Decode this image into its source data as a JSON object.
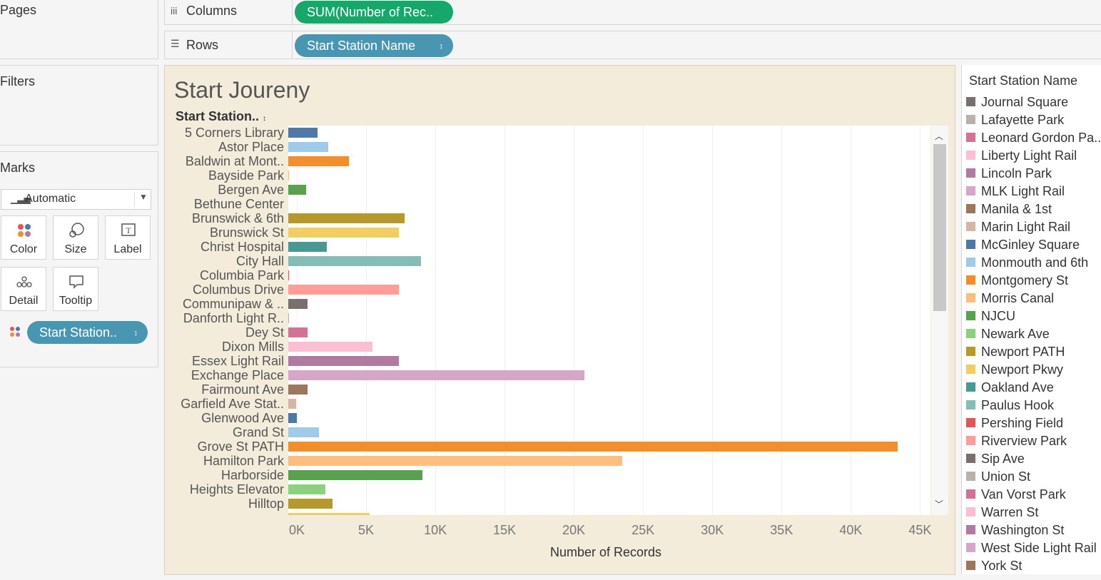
{
  "left": {
    "pages_title": "Pages",
    "filters_title": "Filters",
    "marks_title": "Marks",
    "mark_type": "Automatic",
    "mark_cards": [
      "Color",
      "Size",
      "Label",
      "Detail",
      "Tooltip"
    ],
    "color_pill": "Start Station.."
  },
  "shelves": {
    "columns_label": "Columns",
    "columns_pill": "SUM(Number of Rec..",
    "rows_label": "Rows",
    "rows_pill": "Start Station Name"
  },
  "colors": {
    "columns_pill": "#15a86a",
    "rows_pill": "#4996b2",
    "view_bg": "#f3ecdb"
  },
  "chart_data": {
    "type": "bar",
    "orientation": "horizontal",
    "title": "Start Joureny",
    "row_header": "Start Station..",
    "xlabel": "Number of Records",
    "xlim": [
      0,
      46000
    ],
    "x_ticks": [
      "0K",
      "5K",
      "10K",
      "15K",
      "20K",
      "25K",
      "30K",
      "35K",
      "40K",
      "45K"
    ],
    "categories": [
      "5 Corners Library",
      "Astor Place",
      "Baldwin at Mont..",
      "Bayside Park",
      "Bergen Ave",
      "Bethune Center",
      "Brunswick & 6th",
      "Brunswick St",
      "Christ Hospital",
      "City Hall",
      "Columbia Park",
      "Columbus Drive",
      "Communipaw & ..",
      "Danforth Light R..",
      "Dey St",
      "Dixon Mills",
      "Essex Light Rail",
      "Exchange Place",
      "Fairmount Ave",
      "Garfield Ave Stat..",
      "Glenwood Ave",
      "Grand St",
      "Grove St PATH",
      "Hamilton Park",
      "Harborside",
      "Heights Elevator",
      "Hilltop"
    ],
    "values": [
      2100,
      2900,
      4400,
      50,
      1300,
      0,
      8400,
      8000,
      2800,
      9600,
      50,
      8000,
      1400,
      50,
      1400,
      6100,
      8000,
      21400,
      1400,
      550,
      600,
      2200,
      44000,
      24100,
      9700,
      2700,
      3200
    ],
    "bar_colors": [
      "#4e79a7",
      "#a0cbe8",
      "#f28e2b",
      "#ffbe7d",
      "#59a14f",
      "#8cd17d",
      "#b6992d",
      "#f1ce63",
      "#499894",
      "#86bcb6",
      "#e15759",
      "#ff9d9a",
      "#79706e",
      "#bab0ac",
      "#d37295",
      "#fabfd2",
      "#b07aa1",
      "#d4a6c8",
      "#9d7660",
      "#d7b5a6",
      "#4e79a7",
      "#a0cbe8",
      "#f28e2b",
      "#ffbe7d",
      "#59a14f",
      "#8cd17d",
      "#b6992d"
    ],
    "grid": true
  },
  "legend": {
    "title": "Start Station Name",
    "items": [
      {
        "label": "Journal Square",
        "color": "#79706e"
      },
      {
        "label": "Lafayette Park",
        "color": "#bab0ac"
      },
      {
        "label": "Leonard Gordon Pa..",
        "color": "#d37295"
      },
      {
        "label": "Liberty Light Rail",
        "color": "#fabfd2"
      },
      {
        "label": "Lincoln Park",
        "color": "#b07aa1"
      },
      {
        "label": "MLK Light Rail",
        "color": "#d4a6c8"
      },
      {
        "label": "Manila & 1st",
        "color": "#9d7660"
      },
      {
        "label": "Marin Light Rail",
        "color": "#d7b5a6"
      },
      {
        "label": "McGinley Square",
        "color": "#4e79a7"
      },
      {
        "label": "Monmouth and 6th",
        "color": "#a0cbe8"
      },
      {
        "label": "Montgomery St",
        "color": "#f28e2b"
      },
      {
        "label": "Morris Canal",
        "color": "#ffbe7d"
      },
      {
        "label": "NJCU",
        "color": "#59a14f"
      },
      {
        "label": "Newark Ave",
        "color": "#8cd17d"
      },
      {
        "label": "Newport PATH",
        "color": "#b6992d"
      },
      {
        "label": "Newport Pkwy",
        "color": "#f1ce63"
      },
      {
        "label": "Oakland Ave",
        "color": "#499894"
      },
      {
        "label": "Paulus Hook",
        "color": "#86bcb6"
      },
      {
        "label": "Pershing Field",
        "color": "#e15759"
      },
      {
        "label": "Riverview Park",
        "color": "#ff9d9a"
      },
      {
        "label": "Sip Ave",
        "color": "#79706e"
      },
      {
        "label": "Union St",
        "color": "#bab0ac"
      },
      {
        "label": "Van Vorst Park",
        "color": "#d37295"
      },
      {
        "label": "Warren St",
        "color": "#fabfd2"
      },
      {
        "label": "Washington St",
        "color": "#b07aa1"
      },
      {
        "label": "West Side Light Rail",
        "color": "#d4a6c8"
      },
      {
        "label": "York St",
        "color": "#9d7660"
      }
    ]
  }
}
